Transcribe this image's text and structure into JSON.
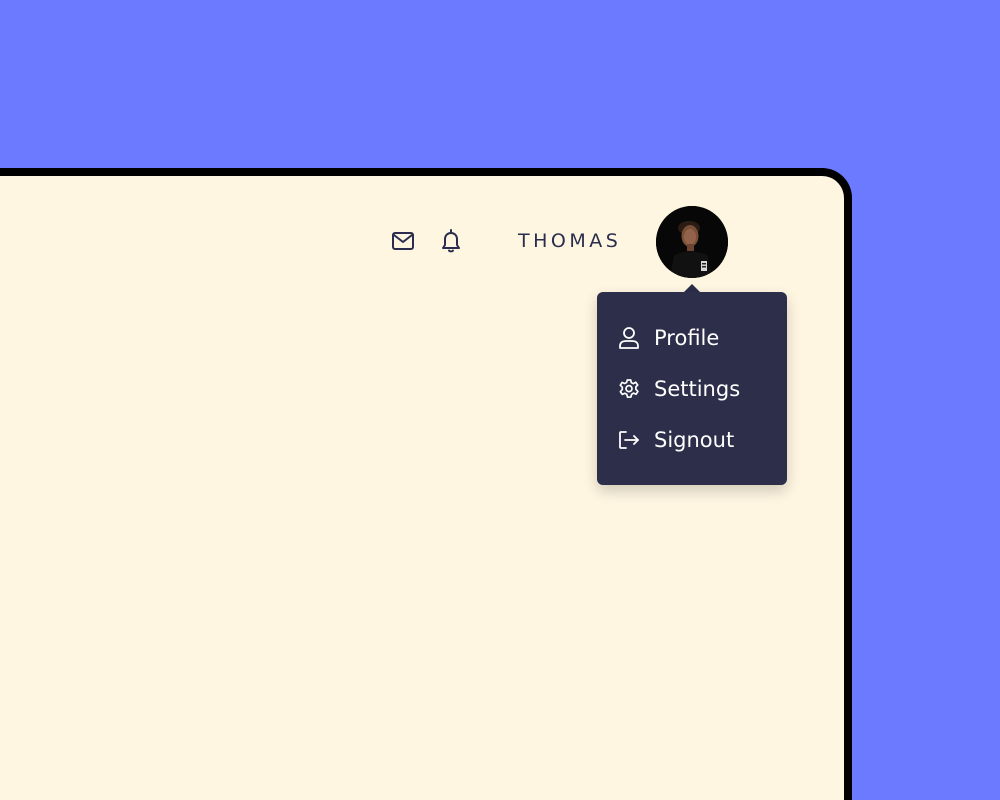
{
  "header": {
    "user_name": "THOMAS",
    "icons": [
      "mail-icon",
      "bell-icon"
    ]
  },
  "user_menu": {
    "items": [
      {
        "label": "Profile",
        "icon": "user-icon"
      },
      {
        "label": "Settings",
        "icon": "gear-icon"
      },
      {
        "label": "Signout",
        "icon": "sign-out-icon"
      }
    ]
  },
  "colors": {
    "background": "#6b7aff",
    "screen": "#fef6e1",
    "menu": "#2c2e4a",
    "text_dark": "#2a2d4d",
    "menu_text": "#ffffff"
  }
}
